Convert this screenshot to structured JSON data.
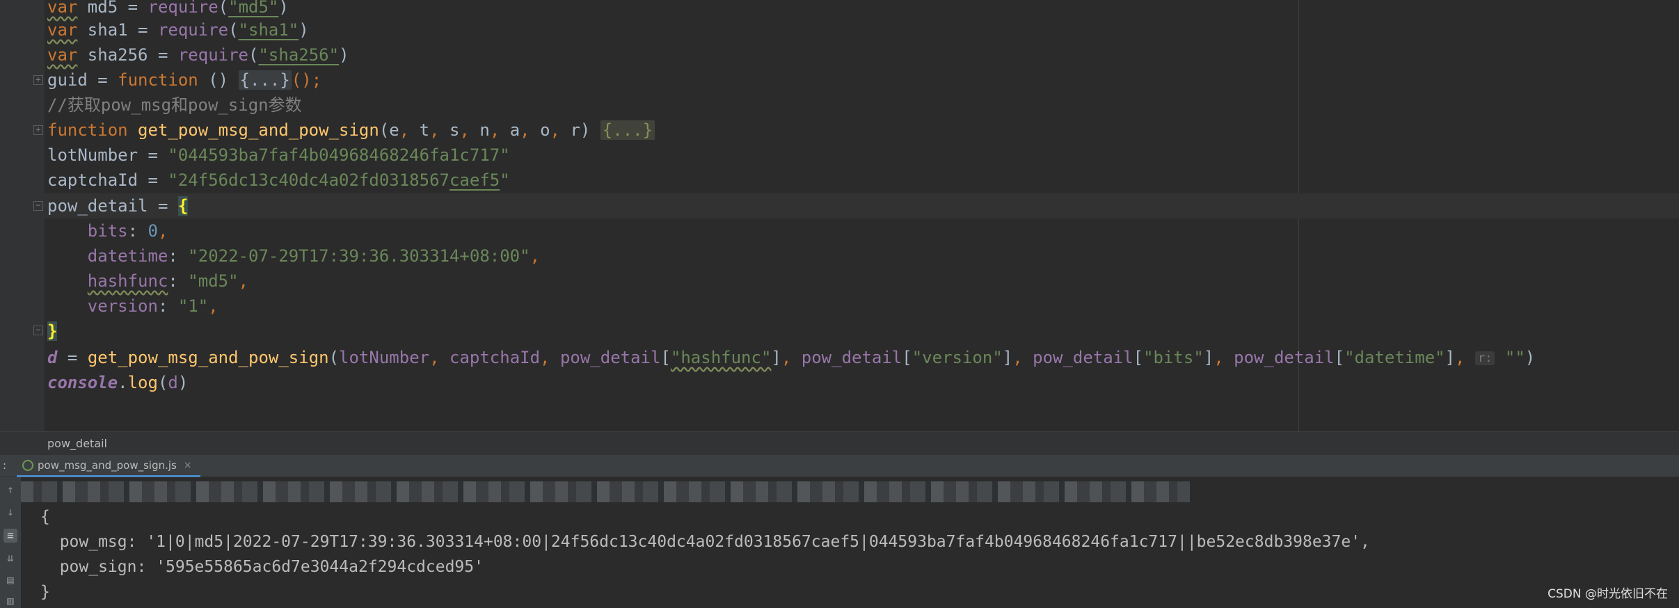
{
  "editor": {
    "lines": {
      "l1": {
        "kw": "var",
        "name": " md5 = ",
        "call": "require",
        "open": "(",
        "arg": "\"md5\"",
        "close": ")"
      },
      "l2": {
        "kw": "var",
        "name": " sha1 = ",
        "call": "require",
        "open": "(",
        "arg": "\"sha1\"",
        "close": ")"
      },
      "l3": {
        "kw": "var",
        "name": " sha256 = ",
        "call": "require",
        "open": "(",
        "arg": "\"sha256\"",
        "close": ")"
      },
      "l4": {
        "name": "guid = ",
        "kw": "function",
        "parens": " () ",
        "folded": "{...}",
        "tail": "();"
      },
      "l5": {
        "comment": "//获取pow_msg和pow_sign参数"
      },
      "l6": {
        "kw": "function",
        "fn": " get_pow_msg_and_pow_sign",
        "open": "(",
        "params": [
          "e",
          "t",
          "s",
          "n",
          "a",
          "o",
          "r"
        ],
        "sep": ", ",
        "close": ") ",
        "folded": "{...}"
      },
      "l7": {
        "name": "lotNumber = ",
        "value": "\"044593ba7faf4b04968468246fa1c717\""
      },
      "l8": {
        "name": "captchaId = ",
        "value_a": "\"24f56dc13c40dc4a02fd0318567",
        "value_b": "caef5",
        "value_c": "\""
      },
      "l9": {
        "name": "pow_detail = ",
        "brace": "{"
      },
      "l10": {
        "key": "    bits",
        "colon": ": ",
        "value": "0",
        "comma": ","
      },
      "l11": {
        "key": "    datetime",
        "colon": ": ",
        "value": "\"2022-07-29T17:39:36.303314+08:00\"",
        "comma": ","
      },
      "l12": {
        "indent": "    ",
        "key": "hashfunc",
        "colon": ": ",
        "value": "\"md5\"",
        "comma": ","
      },
      "l13": {
        "key": "    version",
        "colon": ": ",
        "value": "\"1\"",
        "comma": ","
      },
      "l14": {
        "brace": "}"
      },
      "l15": {
        "var": "d",
        "eq": " = ",
        "fn": "get_pow_msg_and_pow_sign",
        "open": "(",
        "a1": "lotNumber",
        "sep": ", ",
        "a2": "captchaId",
        "obj": "pow_detail",
        "lb": "[",
        "rb": "]",
        "k1": "\"hashfunc\"",
        "k2": "\"version\"",
        "k3": "\"bits\"",
        "k4": "\"datetime\"",
        "hint": "r:",
        "last": " \"\"",
        "close": ")"
      },
      "l16": {
        "obj": "console",
        "dot": ".",
        "method": "log",
        "open": "(",
        "arg": "d",
        "close": ")"
      }
    }
  },
  "breadcrumb": {
    "label": "pow_detail"
  },
  "run_tab": {
    "prefix": ":",
    "label": "pow_msg_and_pow_sign.js",
    "close": "×"
  },
  "console": {
    "lines": {
      "c1": "{",
      "c2": "  pow_msg: '1|0|md5|2022-07-29T17:39:36.303314+08:00|24f56dc13c40dc4a02fd0318567caef5|044593ba7faf4b04968468246fa1c717||be52ec8db398e37e',",
      "c3": "  pow_sign: '595e55865ac6d7e3044a2f294cdced95'",
      "c4": "}"
    },
    "tools": [
      "rerun-icon",
      "down-icon",
      "soft-wrap-icon",
      "scroll-to-end-icon",
      "print-icon",
      "trash-icon"
    ]
  },
  "watermark": "CSDN @时光依旧不在",
  "colors": {
    "background": "#2b2b2b",
    "keyword": "#cc7832",
    "string": "#6a8759",
    "function": "#ffc66d",
    "number": "#6897bb",
    "property": "#9876aa"
  }
}
